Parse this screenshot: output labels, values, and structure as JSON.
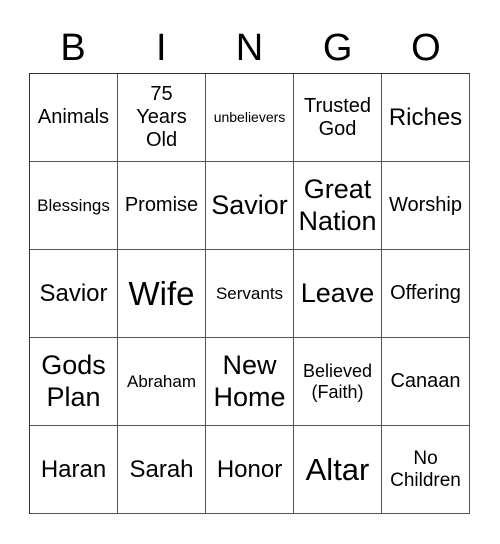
{
  "header": {
    "letters": [
      "B",
      "I",
      "N",
      "G",
      "O"
    ]
  },
  "board": {
    "rows": [
      [
        "Animals",
        "75 Years Old",
        "unbelievers",
        "Trusted God",
        "Riches"
      ],
      [
        "Blessings",
        "Promise",
        "Savior",
        "Great Nation",
        "Worship"
      ],
      [
        "Savior",
        "Wife",
        "Servants",
        "Leave",
        "Offering"
      ],
      [
        "Gods Plan",
        "Abraham",
        "New Home",
        "Believed (Faith)",
        "Canaan"
      ],
      [
        "Haran",
        "Sarah",
        "Honor",
        "Altar",
        "No Children"
      ]
    ]
  }
}
